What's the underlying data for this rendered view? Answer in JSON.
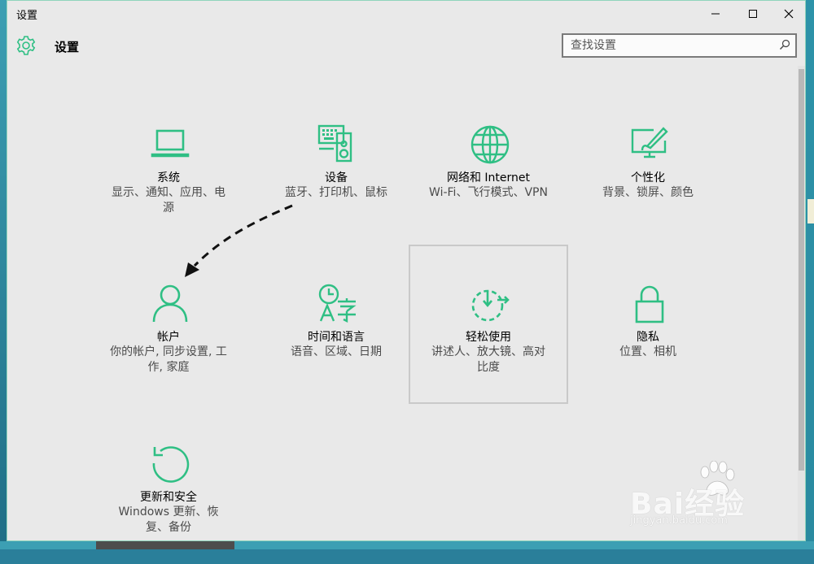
{
  "window": {
    "title": "设置",
    "controls": {
      "minimize_icon": "minimize-icon",
      "maximize_icon": "maximize-icon",
      "close_icon": "close-icon"
    }
  },
  "header": {
    "title": "设置",
    "icon": "gear-icon",
    "search_placeholder": "查找设置",
    "search_icon": "search-icon"
  },
  "accent_color": "#2fbf84",
  "categories": [
    {
      "label": "系统",
      "desc": "显示、通知、应用、电源",
      "icon": "laptop-icon"
    },
    {
      "label": "设备",
      "desc": "蓝牙、打印机、鼠标",
      "icon": "devices-icon"
    },
    {
      "label": "网络和 Internet",
      "desc": "Wi-Fi、飞行模式、VPN",
      "icon": "globe-icon"
    },
    {
      "label": "个性化",
      "desc": "背景、锁屏、颜色",
      "icon": "personalization-icon"
    },
    {
      "label": "帐户",
      "desc": "你的帐户, 同步设置, 工作, 家庭",
      "icon": "person-icon"
    },
    {
      "label": "时间和语言",
      "desc": "语音、区域、日期",
      "icon": "time-language-icon"
    },
    {
      "label": "轻松使用",
      "desc": "讲述人、放大镜、高对比度",
      "icon": "ease-of-access-icon"
    },
    {
      "label": "隐私",
      "desc": "位置、相机",
      "icon": "lock-icon"
    },
    {
      "label": "更新和安全",
      "desc": "Windows 更新、恢复、备份",
      "icon": "update-icon"
    }
  ],
  "watermark": {
    "brand": "Bai经验",
    "site": "jingyan.baidu.com"
  }
}
